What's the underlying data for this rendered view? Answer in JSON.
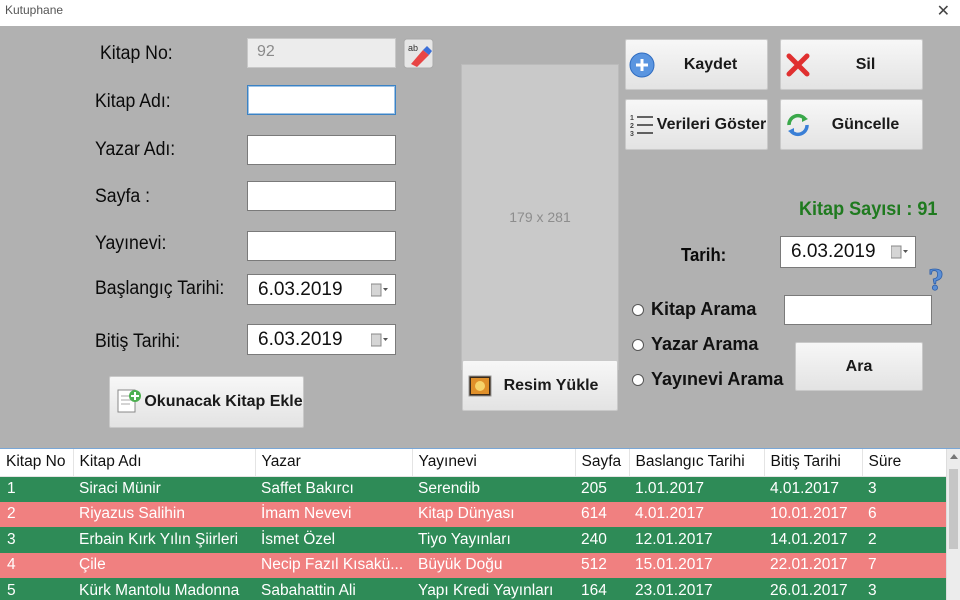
{
  "window": {
    "title": "Kutuphane"
  },
  "form": {
    "kitap_no_label": "Kitap No:",
    "kitap_no_value": "92",
    "kitap_adi_label": "Kitap Adı:",
    "yazar_adi_label": "Yazar Adı:",
    "sayfa_label": "Sayfa :",
    "yayinevi_label": "Yayınevi:",
    "baslangic_label": "Başlangıç Tarihi:",
    "baslangic_value": "6.03.2019",
    "bitis_label": "Bitiş Tarihi:",
    "bitis_value": "6.03.2019",
    "okunacak_button": "Okunacak Kitap Ekle"
  },
  "image_box": {
    "placeholder": "179 x 281",
    "upload_button": "Resim Yükle"
  },
  "actions": {
    "kaydet": "Kaydet",
    "sil": "Sil",
    "verileri_goster": "Verileri Göster",
    "guncelle": "Güncelle"
  },
  "stats": {
    "kitap_sayisi": "Kitap Sayısı : 91"
  },
  "tarih": {
    "label": "Tarih:",
    "value": "6.03.2019"
  },
  "search": {
    "options": [
      "Kitap Arama",
      "Yazar Arama",
      "Yayınevi Arama"
    ],
    "button": "Ara"
  },
  "grid": {
    "columns": [
      "Kitap No",
      "Kitap Adı",
      "Yazar",
      "Yayınevi",
      "Sayfa",
      "Baslangıc Tarihi",
      "Bitiş Tarihi",
      "Süre"
    ],
    "rows": [
      [
        "1",
        "Siraci Münir",
        "Saffet Bakırcı",
        "Serendib",
        "205",
        "1.01.2017",
        "4.01.2017",
        "3"
      ],
      [
        "2",
        "Riyazus Salihin",
        "İmam Nevevi",
        "Kitap Dünyası",
        "614",
        "4.01.2017",
        "10.01.2017",
        "6"
      ],
      [
        "3",
        "Erbain Kırk Yılın Şiirleri",
        "İsmet Özel",
        "Tiyo Yayınları",
        "240",
        "12.01.2017",
        "14.01.2017",
        "2"
      ],
      [
        "4",
        "Çile",
        "Necip Fazıl Kısakü...",
        "Büyük Doğu",
        "512",
        "15.01.2017",
        "22.01.2017",
        "7"
      ],
      [
        "5",
        "Kürk Mantolu Madonna",
        "Sabahattin Ali",
        "Yapı Kredi Yayınları",
        "164",
        "23.01.2017",
        "26.01.2017",
        "3"
      ]
    ],
    "row_colors": {
      "green": "#2e8b57",
      "red": "#f08080"
    }
  }
}
